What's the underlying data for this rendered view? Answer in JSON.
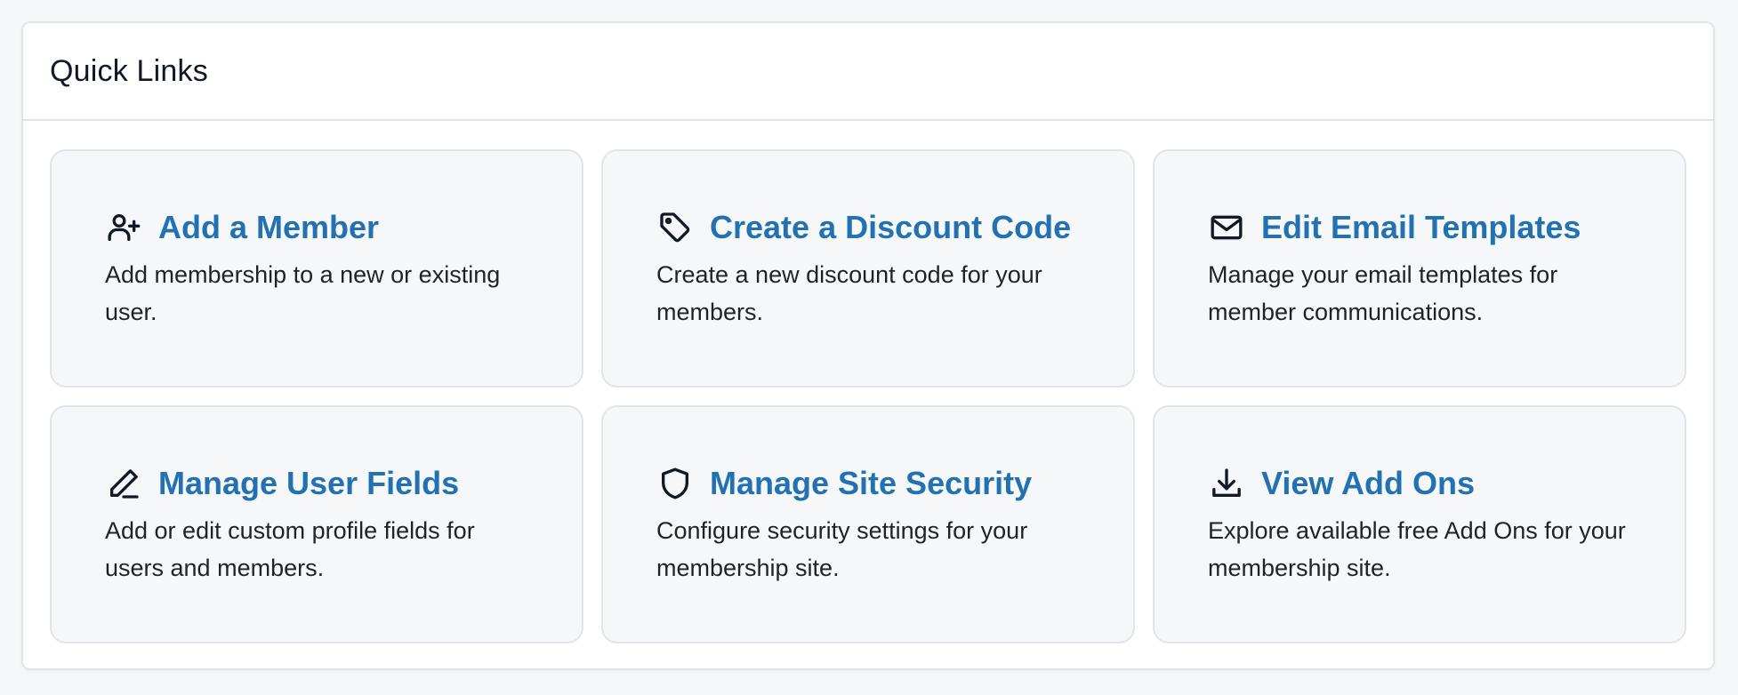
{
  "panel": {
    "title": "Quick Links"
  },
  "links": [
    {
      "title": "Add a Member",
      "description": "Add membership to a new or existing user.",
      "icon": "user-plus-icon"
    },
    {
      "title": "Create a Discount Code",
      "description": "Create a new discount code for your members.",
      "icon": "tag-icon"
    },
    {
      "title": "Edit Email Templates",
      "description": "Manage your email templates for member communications.",
      "icon": "envelope-icon"
    },
    {
      "title": "Manage User Fields",
      "description": "Add or edit custom profile fields for users and members.",
      "icon": "pencil-icon"
    },
    {
      "title": "Manage Site Security",
      "description": "Configure security settings for your membership site.",
      "icon": "shield-icon"
    },
    {
      "title": "View Add Ons",
      "description": "Explore available free Add Ons for your membership site.",
      "icon": "download-icon"
    }
  ],
  "colors": {
    "link": "#2271b1",
    "card_background": "#f6f7f9",
    "border": "#e1e4e8"
  }
}
